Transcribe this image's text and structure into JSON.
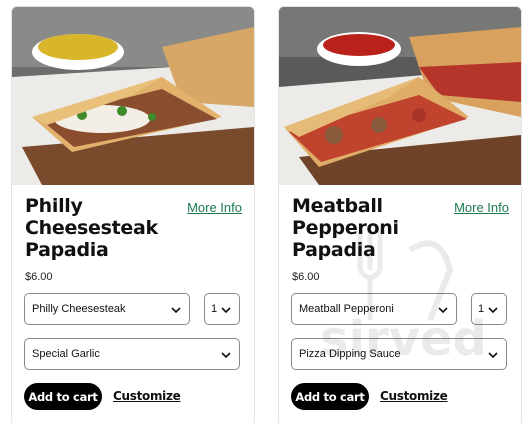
{
  "cards": [
    {
      "title": "Philly Cheesesteak Papadia",
      "title_lines": [
        "Philly",
        "Cheesesteak",
        "Papadia"
      ],
      "more_info": "More Info",
      "price": "$6.00",
      "item_select": "Philly Cheesesteak",
      "qty_select": "1",
      "sauce_select": "Special Garlic",
      "add_to_cart": "Add to cart",
      "customize": "Customize"
    },
    {
      "title": "Meatball Pepperoni Papadia",
      "title_lines": [
        "Meatball",
        "Pepperoni",
        "Papadia"
      ],
      "more_info": "More Info",
      "price": "$6.00",
      "item_select": "Meatball Pepperoni",
      "qty_select": "1",
      "sauce_select": "Pizza Dipping Sauce",
      "add_to_cart": "Add to cart",
      "customize": "Customize"
    }
  ],
  "watermark": "sirved",
  "colors": {
    "link_green": "#1e7a4e",
    "button_black": "#000000"
  }
}
